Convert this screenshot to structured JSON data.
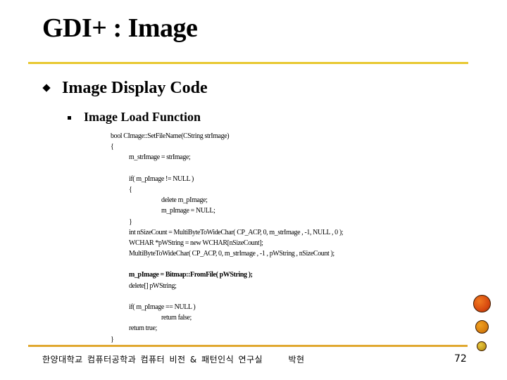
{
  "slide": {
    "title": "GDI+ : Image",
    "bullet_level1": "Image Display Code",
    "bullet_level2": "Image Load Function",
    "code_lines": [
      {
        "text": "bool CImage::SetFileName(CString strImage)",
        "indent": 0
      },
      {
        "text": "{",
        "indent": 0
      },
      {
        "text": "m_strImage = strImage;",
        "indent": 1
      },
      {
        "text": "",
        "indent": 0
      },
      {
        "text": "if( m_pImage != NULL )",
        "indent": 1
      },
      {
        "text": "{",
        "indent": 1
      },
      {
        "text": "delete m_pImage;",
        "indent": 2
      },
      {
        "text": "m_pImage = NULL;",
        "indent": 2
      },
      {
        "text": "}",
        "indent": 1
      },
      {
        "text": "int nSizeCount = MultiByteToWideChar( CP_ACP, 0, m_strImage , -1, NULL , 0 );",
        "indent": 1
      },
      {
        "text": "WCHAR *pWString = new WCHAR[nSizeCount];",
        "indent": 1
      },
      {
        "text": "MultiByteToWideChar( CP_ACP, 0, m_strImage , -1 , pWString , nSizeCount );",
        "indent": 1
      },
      {
        "text": "",
        "indent": 0
      },
      {
        "text": "m_pImage = Bitmap::FromFile( pWString );",
        "indent": 1,
        "bold": true
      },
      {
        "text": "delete[] pWString;",
        "indent": 1
      },
      {
        "text": "",
        "indent": 0
      },
      {
        "text": "if( m_pImage == NULL )",
        "indent": 1
      },
      {
        "text": "return false;",
        "indent": 2
      },
      {
        "text": "return true;",
        "indent": 1
      },
      {
        "text": "}",
        "indent": 0
      }
    ],
    "footer": {
      "institution": "한양대학교 컴퓨터공학과 컴퓨터 비전 & 패턴인식 연구실",
      "author": "박현",
      "page_number": "72"
    },
    "colors": {
      "top_rule": "#e8c830",
      "bottom_rule": "#e0a830",
      "dot_large": "#d84a10",
      "dot_medium": "#d88010",
      "dot_small": "#c8a020"
    }
  }
}
